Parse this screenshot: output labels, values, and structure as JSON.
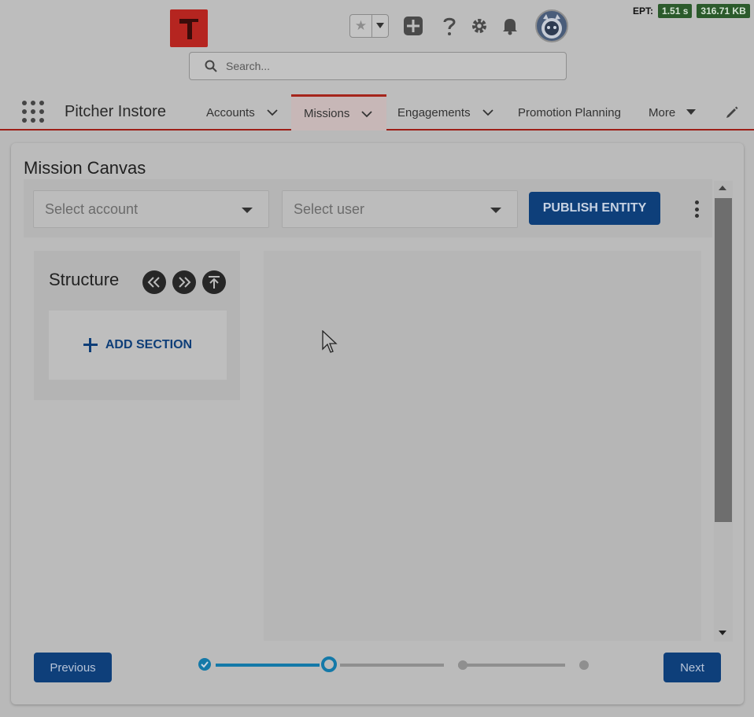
{
  "header": {
    "ept_label": "EPT:",
    "ept_time": "1.51 s",
    "ept_size": "316.71 KB",
    "search_placeholder": "Search...",
    "icons": [
      "star-icon",
      "add-icon",
      "help-icon",
      "setup-gear-icon",
      "notification-bell-icon"
    ]
  },
  "nav": {
    "app_name": "Pitcher Instore",
    "items": [
      {
        "label": "Accounts",
        "has_menu": true
      },
      {
        "label": "Missions",
        "has_menu": true,
        "active": true
      },
      {
        "label": "Engagements",
        "has_menu": true
      },
      {
        "label": "Promotion Planning",
        "has_menu": false
      },
      {
        "label": "More",
        "has_menu": true
      }
    ]
  },
  "card": {
    "title": "Mission Canvas",
    "select_account_placeholder": "Select account",
    "select_user_placeholder": "Select user",
    "publish_label": "PUBLISH ENTITY",
    "structure_title": "Structure",
    "add_section_label": "ADD SECTION",
    "previous_label": "Previous",
    "next_label": "Next",
    "progress": {
      "steps": 4,
      "completed": 1,
      "current": 2
    }
  },
  "colors": {
    "brand_red": "#b52520",
    "primary_blue": "#0e3f7a",
    "progress_blue": "#1479a8"
  }
}
